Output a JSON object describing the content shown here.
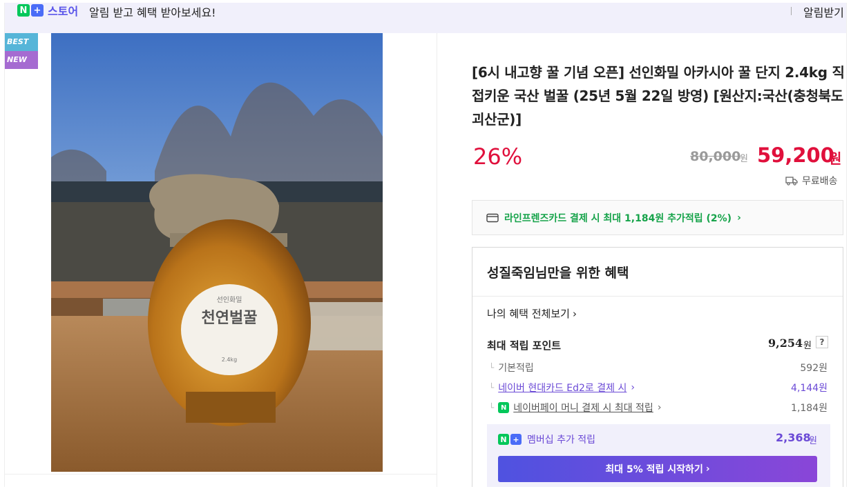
{
  "banner": {
    "logo_n": "N",
    "logo_plus": "+",
    "store_label": "스토어",
    "message": "알림 받고 혜택 받아보세요!",
    "button": "알림받기"
  },
  "badges": {
    "best": "BEST",
    "new": "NEW"
  },
  "image": {
    "jar_label_brand": "선인화밀",
    "jar_label_title": "천연벌꿀",
    "jar_label_weight": "2.4kg"
  },
  "product": {
    "title": "[6시 내고향 꿀 기념 오픈] 선인화밀 아카시아 꿀 단지 2.4kg 직접키운 국산 벌꿀 (25년 5월 22일 방영) [원산지:국산(충청북도 괴산군)]",
    "discount": "26%",
    "original_price": "80,000",
    "original_unit": "원",
    "price": "59,200",
    "price_unit": "원",
    "shipping": "무료배송",
    "card_offer": "라인프렌즈카드 결제 시 최대 1,184원 추가적립 (2%)"
  },
  "benefits": {
    "title": "성질죽임님만을 위한 혜택",
    "view_all": "나의 혜택 전체보기",
    "max_points_label": "최대 적립 포인트",
    "max_points_value": "9,254",
    "max_points_unit": "원",
    "help": "?",
    "rows": [
      {
        "label": "기본적립",
        "value": "592원"
      },
      {
        "label": "네이버 현대카드 Ed2로 결제 시",
        "value": "4,144원"
      },
      {
        "label": "네이버페이 머니 결제 시 최대 적립",
        "value": "1,184원"
      }
    ],
    "membership_label": "멤버십 추가 적립",
    "membership_value": "2,368",
    "membership_unit": "원",
    "cta": "최대 5% 적립 시작하기"
  },
  "colors": {
    "accent": "#e0103c",
    "naver_green": "#03c75a",
    "membership_purple": "#6b4ad6"
  },
  "icons": [
    "truck-icon",
    "card-icon",
    "chevron-right-icon",
    "npay-icon",
    "help-icon"
  ]
}
